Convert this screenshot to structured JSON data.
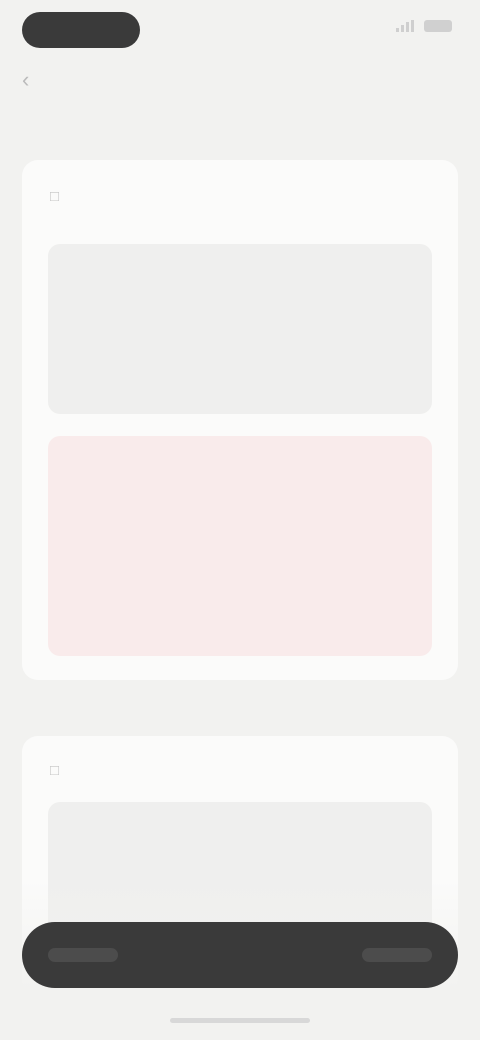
{
  "status_bar": {
    "time": ""
  },
  "header": {
    "title": ""
  },
  "sections": [
    {
      "label": "",
      "card": {
        "title": "",
        "meta": "",
        "blocks": [
          {
            "kind": "neutral",
            "title": "",
            "lines": [
              "",
              "",
              "",
              ""
            ]
          },
          {
            "kind": "warn",
            "title": "",
            "lines": [
              "",
              "",
              "",
              ""
            ]
          }
        ]
      }
    },
    {
      "label": "",
      "card": {
        "title": "",
        "meta": "",
        "blocks": [
          {
            "kind": "neutral",
            "title": "",
            "lines": [
              "",
              ""
            ]
          }
        ]
      }
    }
  ],
  "bottom_bar": {
    "label": ""
  },
  "colors": {
    "background": "#f2f2f0",
    "warn_block": "#f9ebeb",
    "bottom_bar": "#3a3a3a"
  },
  "icons": {
    "back": "chevron-left-icon",
    "card": "document-icon"
  }
}
